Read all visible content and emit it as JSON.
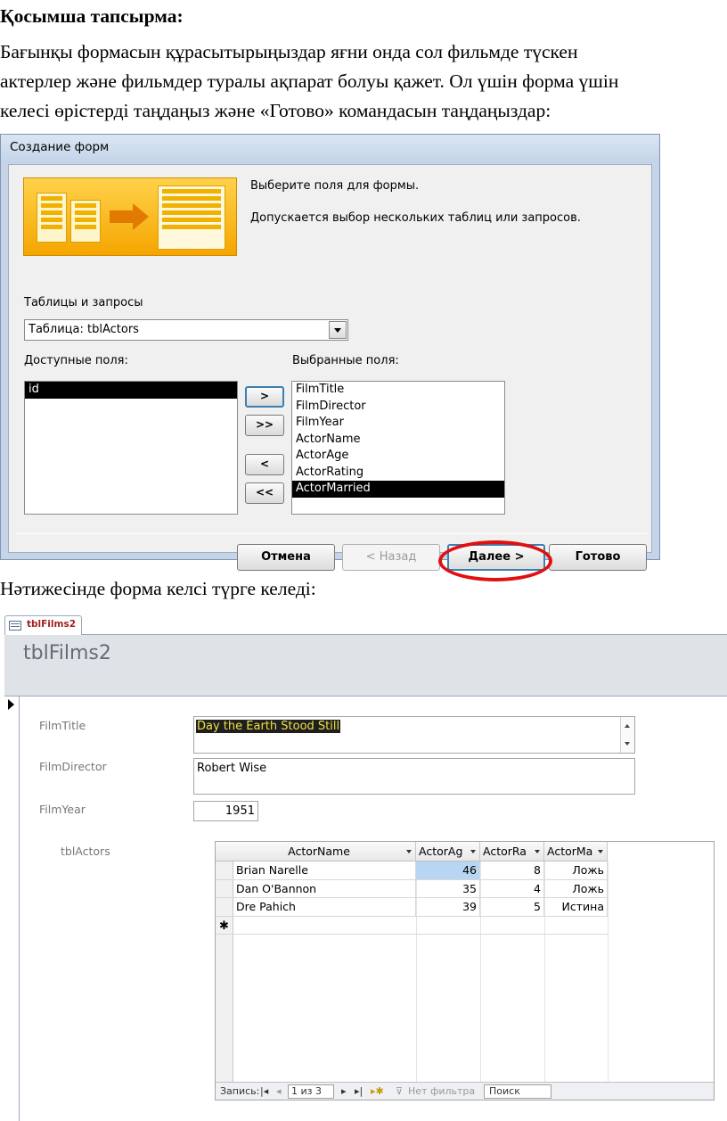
{
  "document": {
    "heading": "Қосымша тапсырма:",
    "paragraph_lines": [
      "Бағынқы формасын құрасытырыңыздар яғни онда сол фильмде түскен",
      "актерлер және фильмдер туралы ақпарат болуы қажет. Ол үшін форма үшін",
      "келесі өрістерді таңдаңыз және «Готово» командасын таңдаңыздар:"
    ],
    "result_text": "Нәтижесінде форма келсі түрге келеді:"
  },
  "dialog": {
    "title": "Создание форм",
    "instruction_1": "Выберите поля для формы.",
    "instruction_2": "Допускается выбор нескольких таблиц или запросов.",
    "tables_label": "Таблицы и запросы",
    "tables_selected": "Таблица: tblActors",
    "available_label": "Доступные поля:",
    "selected_label": "Выбранные поля:",
    "available_fields": [
      "id"
    ],
    "selected_fields": [
      "FilmTitle",
      "FilmDirector",
      "FilmYear",
      "ActorName",
      "ActorAge",
      "ActorRating",
      "ActorMarried"
    ],
    "buttons": {
      "move_one": ">",
      "move_all": ">>",
      "remove_one": "<",
      "remove_all": "<<",
      "cancel": "Отмена",
      "back": "< Назад",
      "next": "Далее >",
      "finish": "Готово"
    }
  },
  "form": {
    "tab_label": "tblFilms2",
    "title": "tblFilms2",
    "fields": {
      "film_title_label": "FilmTitle",
      "film_title_value": "Day the Earth Stood Still",
      "film_director_label": "FilmDirector",
      "film_director_value": "Robert Wise",
      "film_year_label": "FilmYear",
      "film_year_value": "1951"
    },
    "subform_label": "tblActors",
    "grid": {
      "columns": [
        "ActorName",
        "ActorAg",
        "ActorRa",
        "ActorMa"
      ],
      "rows": [
        [
          "Brian Narelle",
          "46",
          "8",
          "Ложь"
        ],
        [
          "Dan O'Bannon",
          "35",
          "4",
          "Ложь"
        ],
        [
          "Dre Pahich",
          "39",
          "5",
          "Истина"
        ]
      ],
      "new_row_marker": "✱"
    },
    "navigator": {
      "label": "Запись:",
      "first": "|◂",
      "prev": "◂",
      "position": "1 из 3",
      "next": "▸",
      "last": "▸|",
      "new": "▸✱",
      "filter": "Нет фильтра",
      "search": "Поиск"
    }
  }
}
